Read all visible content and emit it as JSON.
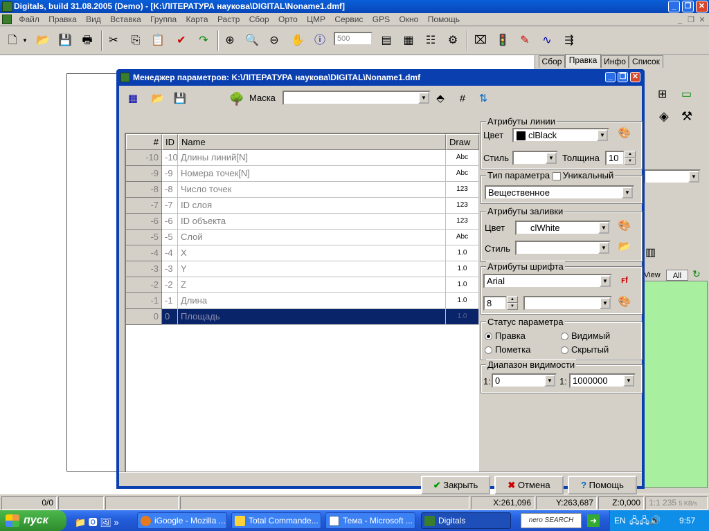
{
  "app": {
    "title": "Digitals, build 31.08.2005 (Demo) - [K:\\ЛІТЕРАТУРА наукова\\DIGITAL\\Noname1.dmf]",
    "menu": [
      "Файл",
      "Правка",
      "Вид",
      "Вставка",
      "Группа",
      "Карта",
      "Растр",
      "Сбор",
      "Орто",
      "ЦМР",
      "Сервис",
      "GPS",
      "Окно",
      "Помощь"
    ],
    "scale_value": "500",
    "right_tabs": [
      "Сбор",
      "Правка",
      "Инфо",
      "Список"
    ],
    "active_tab": "Правка",
    "panel_view_label": "View",
    "panel_all_label": "All"
  },
  "dialog": {
    "title": "Менеджер параметров: K:\\ЛІТЕРАТУРА наукова\\DIGITAL\\Noname1.dmf",
    "mask_label": "Маска",
    "mask_value": "",
    "grid": {
      "headers": {
        "num": "#",
        "id": "ID",
        "name": "Name",
        "draw": "Draw"
      },
      "rows": [
        {
          "num": "-10",
          "id": "-10",
          "name": "Длины линий[N]",
          "draw": "Abc"
        },
        {
          "num": "-9",
          "id": "-9",
          "name": "Номера точек[N]",
          "draw": "Abc"
        },
        {
          "num": "-8",
          "id": "-8",
          "name": "Число точек",
          "draw": "123"
        },
        {
          "num": "-7",
          "id": "-7",
          "name": "ID слоя",
          "draw": "123"
        },
        {
          "num": "-6",
          "id": "-6",
          "name": "ID объекта",
          "draw": "123"
        },
        {
          "num": "-5",
          "id": "-5",
          "name": "Слой",
          "draw": "Abc"
        },
        {
          "num": "-4",
          "id": "-4",
          "name": "X",
          "draw": "1.0"
        },
        {
          "num": "-3",
          "id": "-3",
          "name": "Y",
          "draw": "1.0"
        },
        {
          "num": "-2",
          "id": "-2",
          "name": "Z",
          "draw": "1.0"
        },
        {
          "num": "-1",
          "id": "-1",
          "name": "Длина",
          "draw": "1.0"
        },
        {
          "num": "0",
          "id": "0",
          "name": "Площадь",
          "draw": "1.0"
        }
      ]
    },
    "line_attrs": {
      "legend": "Атрибуты линии",
      "color_label": "Цвет",
      "color_value": "clBlack",
      "style_label": "Стиль",
      "style_value": "",
      "thickness_label": "Толщина",
      "thickness_value": "10"
    },
    "param_type": {
      "legend": "Тип параметра",
      "unique_label": "Уникальный",
      "value": "Вещественное"
    },
    "fill_attrs": {
      "legend": "Атрибуты заливки",
      "color_label": "Цвет",
      "color_value": "clWhite",
      "style_label": "Стиль",
      "style_value": ""
    },
    "font_attrs": {
      "legend": "Атрибуты шрифта",
      "font_value": "Arial",
      "size_value": "8",
      "extra_value": ""
    },
    "status": {
      "legend": "Статус параметра",
      "edit_label": "Правка",
      "visible_label": "Видимый",
      "mark_label": "Пометка",
      "hidden_label": "Скрытый"
    },
    "visibility": {
      "legend": "Диапазон видимости",
      "prefix1": "1:",
      "from_value": "0",
      "prefix2": "1:",
      "to_value": "1000000"
    },
    "buttons": {
      "close": "Закрыть",
      "cancel": "Отмена",
      "help": "Помощь"
    }
  },
  "status_bar": {
    "count": "0/0",
    "x": "X:261,096",
    "y": "Y:263,687",
    "z": "Z:0,000",
    "zoom": "1:1 235",
    "speed": "5 KB/s"
  },
  "taskbar": {
    "start_label": "пуск",
    "tasks": [
      "iGoogle - Mozilla ...",
      "Total Commande...",
      "Тема - Microsoft ...",
      "Digitals"
    ],
    "search_label": "nero SEARCH",
    "lang": "EN",
    "clock": "9:57"
  }
}
